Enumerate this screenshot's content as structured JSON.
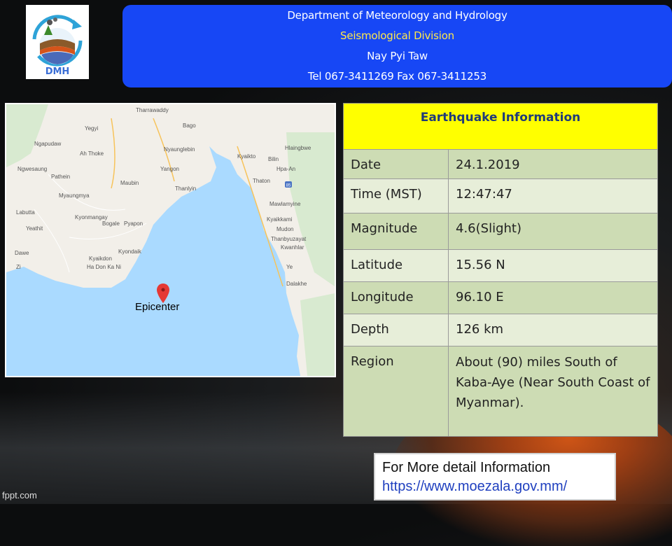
{
  "header": {
    "line1": "Department of Meteorology and Hydrology",
    "line2": "Seismological Division",
    "line3": "Nay Pyi Taw",
    "line4": "Tel 067-3411269 Fax 067-3411253",
    "accent_color": "#1747f5"
  },
  "logo": {
    "text": "DMH"
  },
  "map": {
    "epicenter_label": "Epicenter",
    "places": [
      "Tharrawaddy",
      "Bago",
      "Yegyi",
      "Nyaunglebin",
      "Ngapudaw",
      "Kyaikto",
      "Bilin",
      "Ah Thoke",
      "Hlaingbwe",
      "Ngwesaung",
      "Maubin",
      "Yangon",
      "Thanlyin",
      "Hpa-An",
      "Pathein",
      "Thaton",
      "Myaungmya",
      "Mawlamyine",
      "Kyonmangay",
      "Labutta",
      "Bogale",
      "Pyapon",
      "Kyaikkami",
      "Yeathit",
      "Mudon",
      "Thanbyuzayat",
      "Kyondaik",
      "Dawe",
      "Ha Don Ka Ni",
      "Kwanhlar",
      "Zi",
      "Ye",
      "Kyaikdon",
      "Dalakhe"
    ],
    "shield": "85"
  },
  "info": {
    "title": "Earthquake Information",
    "rows": [
      {
        "key": "Date",
        "value": "24.1.2019"
      },
      {
        "key": "Time (MST)",
        "value": "12:47:47"
      },
      {
        "key": "Magnitude",
        "value": "4.6(Slight)"
      },
      {
        "key": "Latitude",
        "value": "15.56 N"
      },
      {
        "key": "Longitude",
        "value": "96.10 E"
      },
      {
        "key": "Depth",
        "value": "126 km"
      },
      {
        "key": "Region",
        "value": "About (90) miles South of Kaba-Aye (Near South Coast of Myanmar)."
      }
    ],
    "header_color": "#ffff00",
    "row_color_a": "#cddcb4",
    "row_color_b": "#e7eed9"
  },
  "more": {
    "label": "For More detail Information",
    "url": "https://www.moezala.gov.mm/"
  },
  "footer": {
    "brand": "fppt.com"
  }
}
